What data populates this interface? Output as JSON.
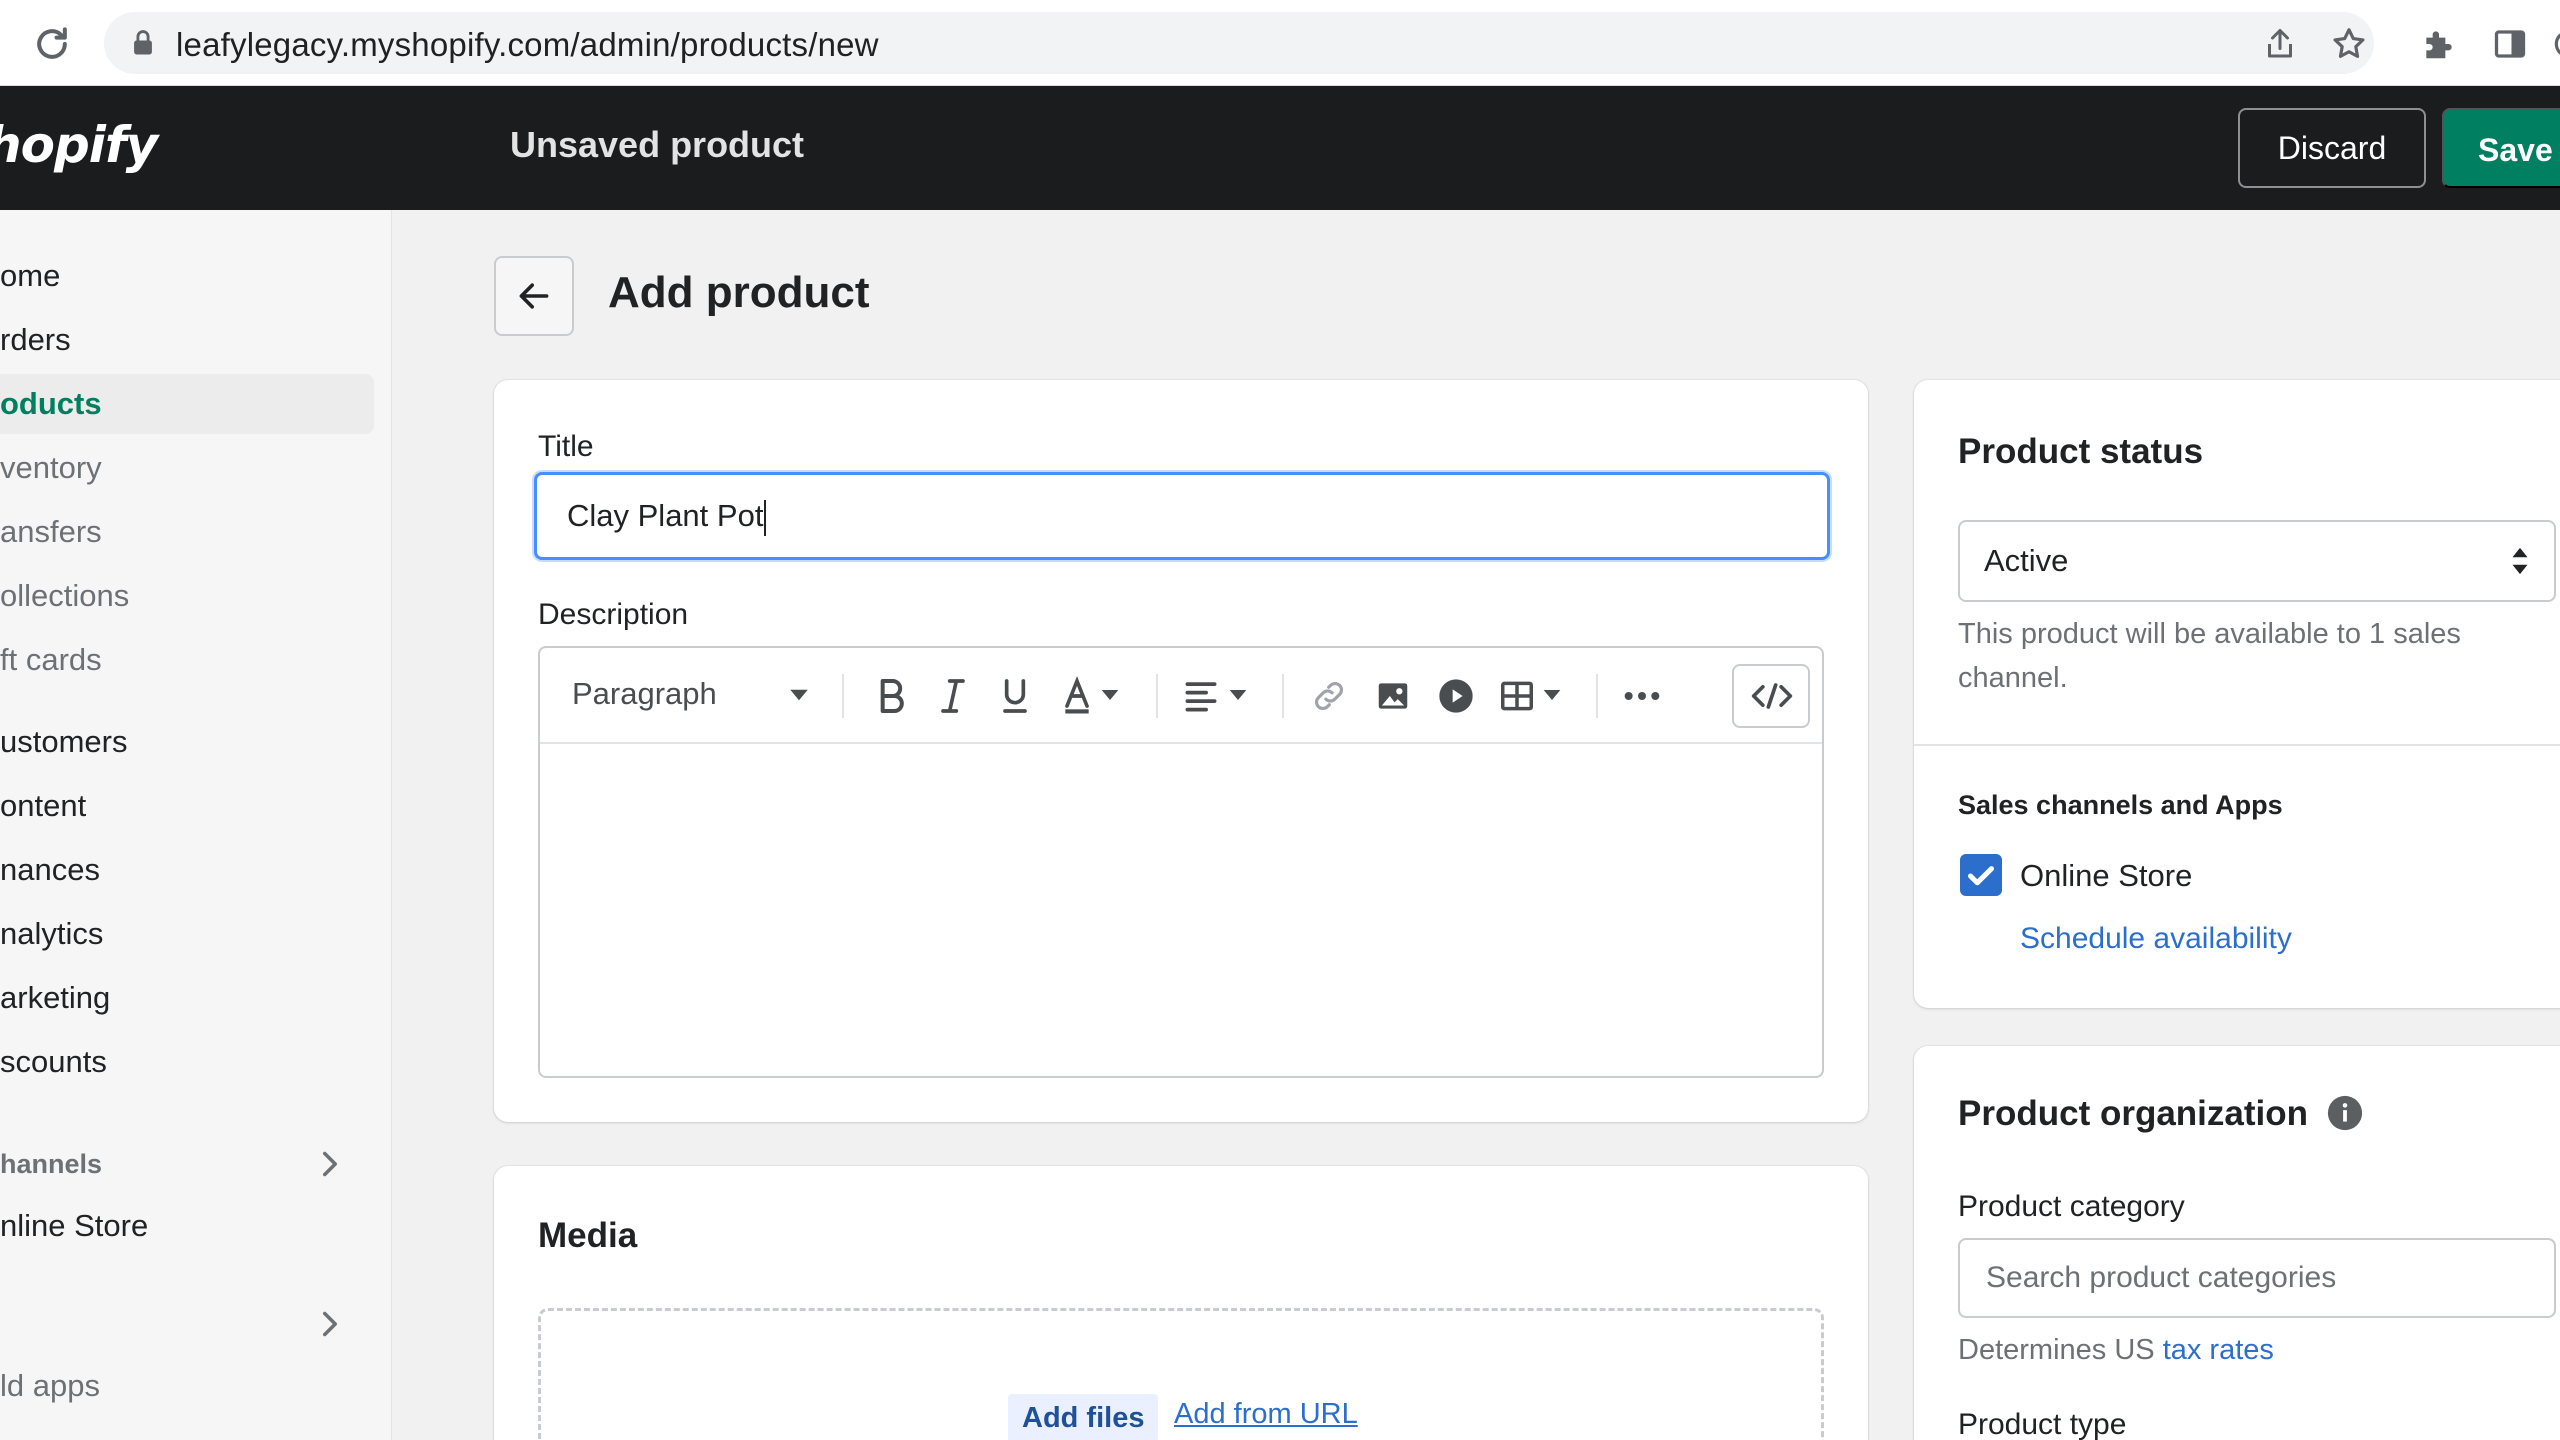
{
  "browser": {
    "url": "leafylegacy.myshopify.com/admin/products/new"
  },
  "topbar": {
    "logo": "hopify",
    "title": "Unsaved product",
    "discard_label": "Discard",
    "save_label": "Save"
  },
  "sidebar": {
    "items": [
      {
        "label": "ome"
      },
      {
        "label": "rders"
      },
      {
        "label": "oducts"
      },
      {
        "label": "ventory"
      },
      {
        "label": "ansfers"
      },
      {
        "label": "ollections"
      },
      {
        "label": "ft cards"
      },
      {
        "label": "ustomers"
      },
      {
        "label": "ontent"
      },
      {
        "label": "nances"
      },
      {
        "label": "nalytics"
      },
      {
        "label": "arketing"
      },
      {
        "label": "scounts"
      }
    ],
    "channels_heading": "hannels",
    "online_store": "nline Store",
    "add_apps": "ld apps"
  },
  "page": {
    "title": "Add product"
  },
  "product_form": {
    "title_label": "Title",
    "title_value": "Clay Plant Pot",
    "description_label": "Description",
    "paragraph_select": "Paragraph",
    "media_heading": "Media",
    "add_files": "Add files",
    "add_from_url": "Add from URL"
  },
  "status_card": {
    "heading": "Product status",
    "status_value": "Active",
    "availability_text": "This product will be available to 1 sales channel.",
    "channels_heading": "Sales channels and Apps",
    "online_store_label": "Online Store",
    "online_store_checked": true,
    "schedule_link": "Schedule availability"
  },
  "organization_card": {
    "heading": "Product organization",
    "category_label": "Product category",
    "category_placeholder": "Search product categories",
    "tax_prefix": "Determines US",
    "tax_link": "tax rates",
    "product_type_label": "Product type"
  },
  "colors": {
    "primary": "#008060",
    "link": "#2c6ecb",
    "focus": "#458fff",
    "topbar": "#1a1c1d"
  }
}
